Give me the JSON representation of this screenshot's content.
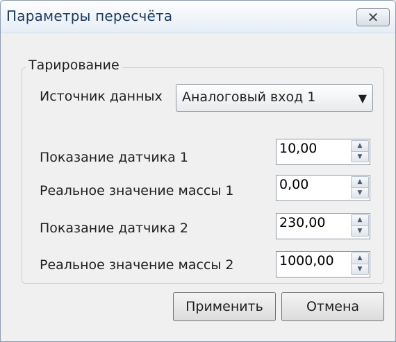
{
  "window": {
    "title": "Параметры пересчёта"
  },
  "group": {
    "legend": "Тарирование"
  },
  "source": {
    "label": "Источник данных",
    "value": "Аналоговый вход 1"
  },
  "fields": [
    {
      "label": "Показание датчика 1",
      "value": "10,00"
    },
    {
      "label": "Реальное значение массы 1",
      "value": "0,00"
    },
    {
      "label": "Показание датчика 2",
      "value": "230,00"
    },
    {
      "label": "Реальное значение массы 2",
      "value": "1000,00"
    }
  ],
  "buttons": {
    "apply": "Применить",
    "cancel": "Отмена"
  },
  "icons": {
    "close": "close-icon",
    "dropdown": "chevron-down-icon",
    "spin_up": "arrow-up-icon",
    "spin_down": "arrow-down-icon"
  }
}
